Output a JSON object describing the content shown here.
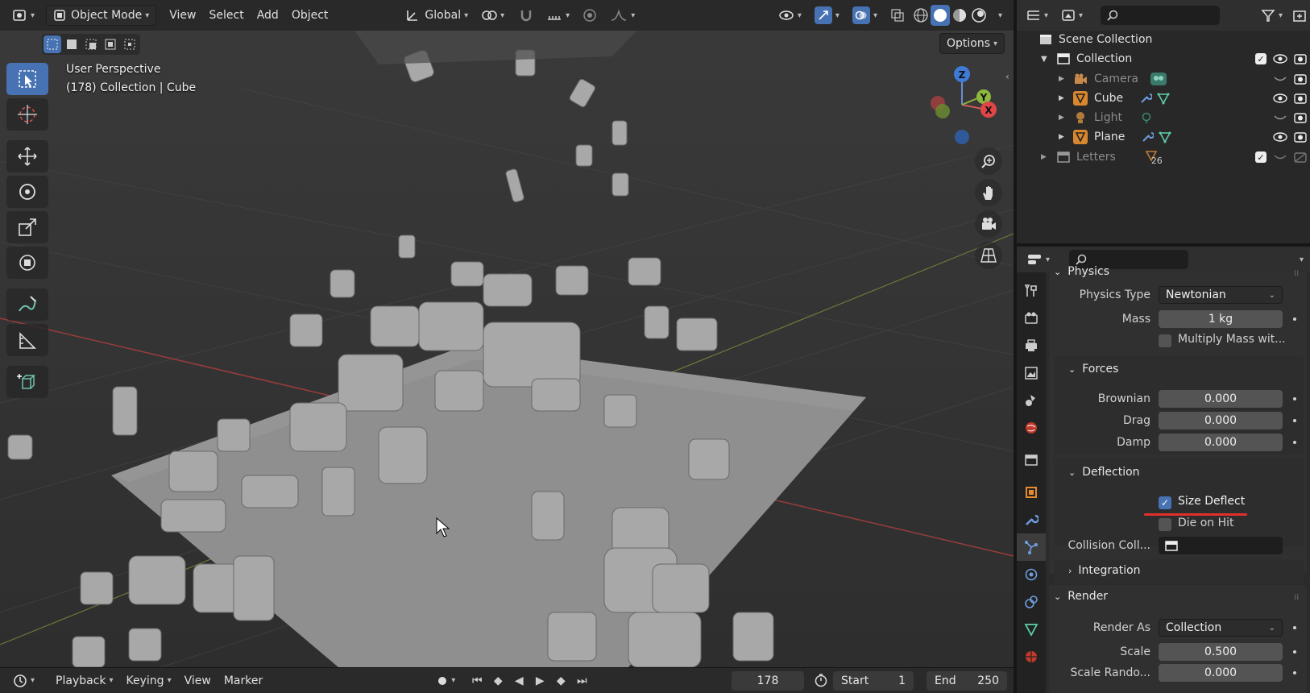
{
  "viewport": {
    "header": {
      "mode": "Object Mode",
      "menus": [
        "View",
        "Select",
        "Add",
        "Object"
      ],
      "transform_orientation": "Global",
      "options_label": "Options"
    },
    "overlay": {
      "perspective": "User Perspective",
      "context": "(178) Collection | Cube"
    },
    "gizmo": {
      "z": "Z",
      "y": "Y",
      "x": "X"
    }
  },
  "timeline": {
    "menus": [
      "Playback",
      "Keying",
      "View",
      "Marker"
    ],
    "current_frame": "178",
    "start_label": "Start",
    "start_value": "1",
    "end_label": "End",
    "end_value": "250"
  },
  "outliner": {
    "scene_collection": "Scene Collection",
    "collection": "Collection",
    "items": [
      {
        "label": "Camera",
        "dim": true
      },
      {
        "label": "Cube",
        "dim": false
      },
      {
        "label": "Light",
        "dim": true
      },
      {
        "label": "Plane",
        "dim": false
      }
    ],
    "letters": "Letters",
    "letters_count": "26"
  },
  "properties": {
    "physics_header": "Physics",
    "physics_type_label": "Physics Type",
    "physics_type_value": "Newtonian",
    "mass_label": "Mass",
    "mass_value": "1 kg",
    "multiply_mass_label": "Multiply Mass wit...",
    "forces_header": "Forces",
    "brownian_label": "Brownian",
    "brownian_value": "0.000",
    "drag_label": "Drag",
    "drag_value": "0.000",
    "damp_label": "Damp",
    "damp_value": "0.000",
    "deflection_header": "Deflection",
    "size_deflect_label": "Size Deflect",
    "die_on_hit_label": "Die on Hit",
    "collision_coll_label": "Collision Coll...",
    "integration_header": "Integration",
    "render_header": "Render",
    "render_as_label": "Render As",
    "render_as_value": "Collection",
    "scale_label": "Scale",
    "scale_value": "0.500",
    "scale_random_label": "Scale Rando...",
    "scale_random_value": "0.000"
  },
  "colors": {
    "accent": "#4772b3",
    "highlight_underline": "#e0302a"
  }
}
